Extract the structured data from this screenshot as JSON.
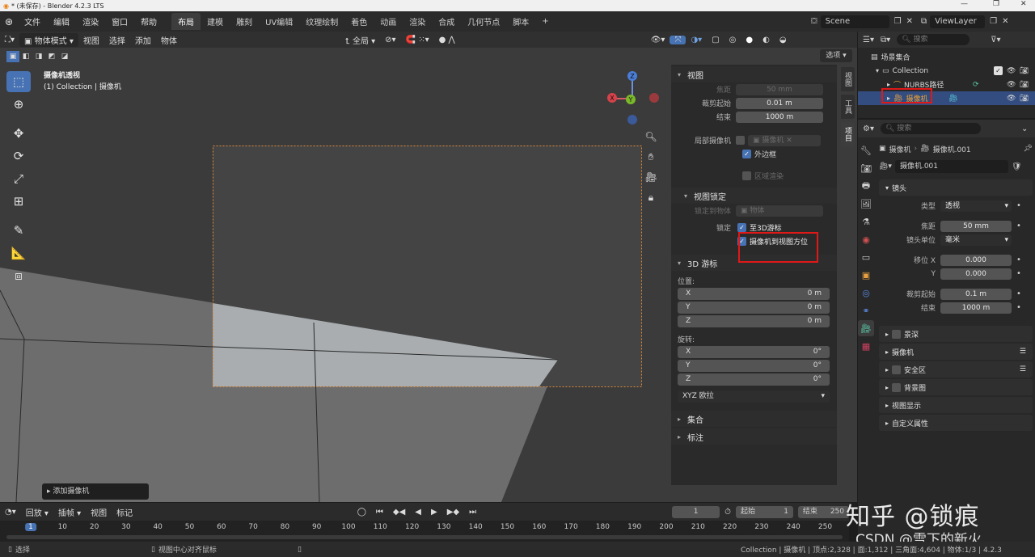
{
  "window": {
    "title": "* (未保存) - Blender 4.2.3 LTS"
  },
  "menu": [
    "文件",
    "编辑",
    "渲染",
    "窗口",
    "帮助"
  ],
  "workspaces": [
    "布局",
    "建模",
    "雕刻",
    "UV编辑",
    "纹理绘制",
    "着色",
    "动画",
    "渲染",
    "合成",
    "几何节点",
    "脚本"
  ],
  "scene": {
    "label": "Scene",
    "viewlayer": "ViewLayer"
  },
  "viewport_header": {
    "mode": "物体模式",
    "menus": [
      "视图",
      "选择",
      "添加",
      "物体"
    ],
    "transform": "全局",
    "options": "选项"
  },
  "viewport": {
    "overlay_line1": "摄像机透视",
    "overlay_line2": "(1) Collection | 摄像机",
    "gizmo_z": "Z",
    "gizmo_y": "Y",
    "gizmo_x": "X",
    "add_camera": "添加摄像机"
  },
  "npanel": {
    "view_title": "视图",
    "focal_label": "焦距",
    "focal_value": "50 mm",
    "clip_start_label": "裁剪起始",
    "clip_start_value": "0.01 m",
    "clip_end_label": "结束",
    "clip_end_value": "1000 m",
    "local_camera_label": "局部摄像机",
    "local_camera_value": "摄像机",
    "outline_label": "外边框",
    "region_render_label": "区域渲染",
    "view_lock_title": "视图锁定",
    "lock_to_object_label": "锁定到物体",
    "lock_to_object_value": "物体",
    "lock_label": "锁定",
    "lock_3d_cursor": "至3D游标",
    "lock_camera_to_view": "摄像机到视图方位",
    "cursor_title": "3D 游标",
    "location_label": "位置:",
    "loc": [
      {
        "axis": "X",
        "value": "0 m"
      },
      {
        "axis": "Y",
        "value": "0 m"
      },
      {
        "axis": "Z",
        "value": "0 m"
      }
    ],
    "rotation_label": "旋转:",
    "rot": [
      {
        "axis": "X",
        "value": "0°"
      },
      {
        "axis": "Y",
        "value": "0°"
      },
      {
        "axis": "Z",
        "value": "0°"
      }
    ],
    "rot_mode": "XYZ 欧拉",
    "collection_title": "集合",
    "annotation_title": "标注",
    "tabs": [
      "视图",
      "工具",
      "项目"
    ]
  },
  "outliner": {
    "search_placeholder": "搜索",
    "scene_collection": "场景集合",
    "collection": "Collection",
    "nurbs": "NURBS路径",
    "camera": "摄像机"
  },
  "properties": {
    "search_placeholder": "搜索",
    "breadcrumb_obj": "摄像机",
    "breadcrumb_data": "摄像机.001",
    "datablock": "摄像机.001",
    "lens_title": "镜头",
    "type_label": "类型",
    "type_value": "透视",
    "focal_label": "焦距",
    "focal_value": "50 mm",
    "unit_label": "镜头单位",
    "unit_value": "毫米",
    "shift_x_label": "移位 X",
    "shift_x_value": "0.000",
    "shift_y_label": "Y",
    "shift_y_value": "0.000",
    "clip_start_label": "裁剪起始",
    "clip_start_value": "0.1 m",
    "clip_end_label": "结束",
    "clip_end_value": "1000 m",
    "sections": [
      "景深",
      "摄像机",
      "安全区",
      "背景图",
      "视图显示",
      "自定义属性"
    ]
  },
  "timeline": {
    "menus": [
      "回放",
      "插帧",
      "视图",
      "标记"
    ],
    "current_frame": "1",
    "start_label": "起始",
    "start_value": "1",
    "end_label": "结束",
    "end_value": "250",
    "ruler": [
      "1",
      "10",
      "20",
      "30",
      "40",
      "50",
      "60",
      "70",
      "80",
      "90",
      "100",
      "110",
      "120",
      "130",
      "140",
      "150",
      "160",
      "170",
      "180",
      "190",
      "200",
      "210",
      "220",
      "230",
      "240",
      "250"
    ]
  },
  "status": {
    "left": "选择",
    "middle": "视图中心对齐鼠标",
    "right": "Collection | 摄像机 | 顶点:2,328 | 面:1,312 | 三角面:4,604 | 物体:1/3 | 4.2.3"
  },
  "watermark": {
    "line1": "知乎 @锁痕",
    "line2": "CSDN @雪下的新火"
  }
}
